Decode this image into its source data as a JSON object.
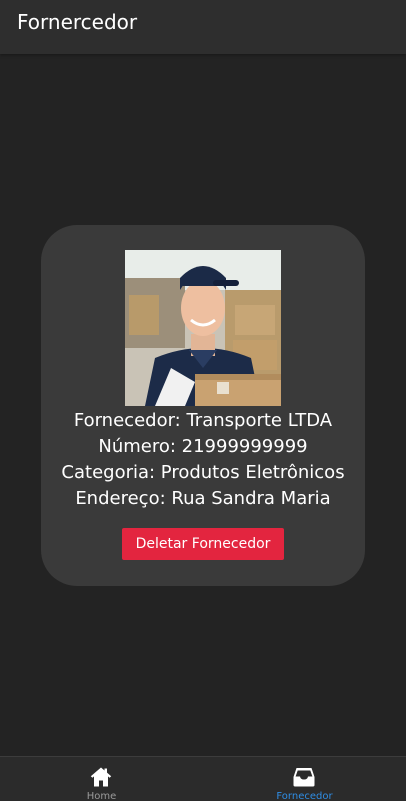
{
  "header": {
    "title": "Fornercedor"
  },
  "supplier": {
    "photo_alt": "delivery-man-with-boxes",
    "lines": [
      "Fornecedor: Transporte LTDA",
      "Número: 21999999999",
      "Categoria: Produtos Eletrônicos",
      "Endereço: Rua Sandra Maria"
    ],
    "delete_label": "Deletar Fornecedor"
  },
  "tabbar": {
    "tabs": [
      {
        "label": "Home",
        "icon": "home-icon",
        "active": false
      },
      {
        "label": "Fornecedor",
        "icon": "inbox-icon",
        "active": true
      }
    ]
  },
  "colors": {
    "background": "#232323",
    "card": "#3a3a3a",
    "delete_button": "#e3253f",
    "active_tab": "#2f8de4",
    "inactive_tab": "#9a9a9a"
  }
}
